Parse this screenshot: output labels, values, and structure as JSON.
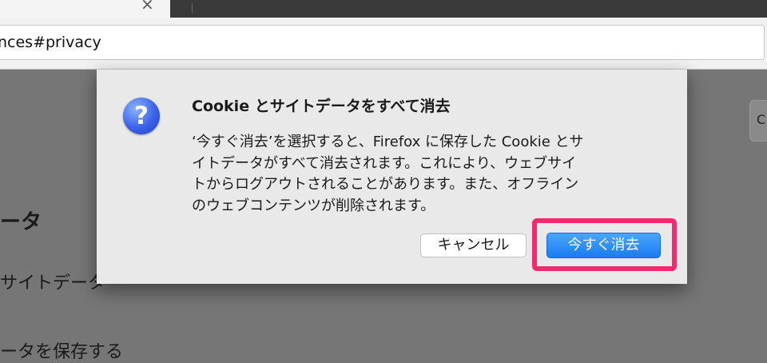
{
  "browser": {
    "tab_close_glyph": "×",
    "url": "nces#privacy"
  },
  "background_page": {
    "heading_fragment": "ータ",
    "text_fragment_1": "サイトデータ",
    "text_fragment_2": "ータを保存する",
    "right_button_fragment": "C"
  },
  "dialog": {
    "icon": "question-icon",
    "title": "Cookie とサイトデータをすべて消去",
    "body_lines": [
      "‘今すぐ消去’を選択すると、Firefox に保存した Cookie とサ",
      "イトデータがすべて消去されます。これにより、ウェブサイ",
      "トからログアウトされることがあります。また、オフライン",
      "のウェブコンテンツが削除されます。"
    ],
    "cancel_label": "キャンセル",
    "clear_label": "今すぐ消去"
  },
  "colors": {
    "highlight": "#f3286e",
    "primary_button": "#1b7bf0",
    "overlay": "#767676"
  }
}
